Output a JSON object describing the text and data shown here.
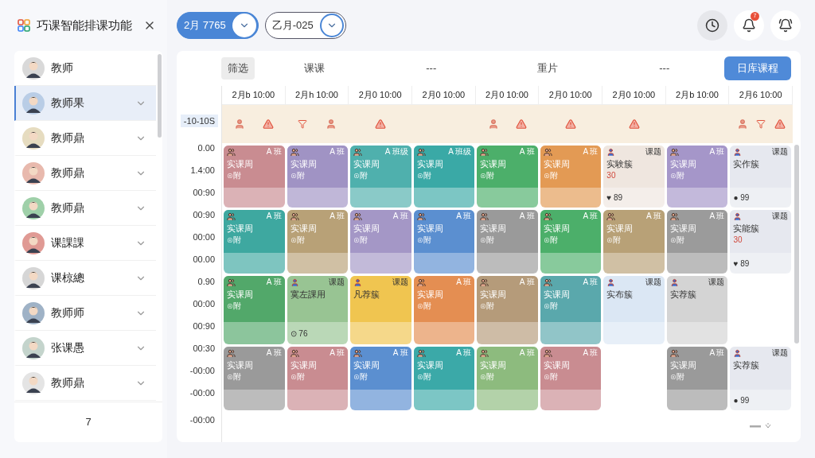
{
  "sidebar": {
    "title": "巧课智能排课功能",
    "teachers": [
      {
        "name": "教师",
        "color": "#d9d9d9",
        "expandable": false,
        "selected": false
      },
      {
        "name": "教师果",
        "color": "#b9cde6",
        "expandable": true,
        "selected": true
      },
      {
        "name": "教师鼎",
        "color": "#e6dcc0",
        "expandable": true,
        "selected": false
      },
      {
        "name": "教师鼎",
        "color": "#e8b9ad",
        "expandable": true,
        "selected": false
      },
      {
        "name": "教师鼎",
        "color": "#9fd0a9",
        "expandable": true,
        "selected": false
      },
      {
        "name": "课課課",
        "color": "#e09a94",
        "expandable": true,
        "selected": false
      },
      {
        "name": "课椋總",
        "color": "#d6d6d6",
        "expandable": true,
        "selected": false
      },
      {
        "name": "教师师",
        "color": "#9fb2c6",
        "expandable": true,
        "selected": false
      },
      {
        "name": "张课愚",
        "color": "#c4d4cc",
        "expandable": true,
        "selected": false
      },
      {
        "name": "教师鼎",
        "color": "#e4e4e4",
        "expandable": true,
        "selected": false
      }
    ],
    "footer": "7"
  },
  "filters": [
    {
      "label": "2月 7765",
      "selected": true
    },
    {
      "label": "乙月-025",
      "selected": false
    }
  ],
  "notification_badge": "7",
  "toolbar": {
    "tabs": [
      {
        "label": "筛选",
        "selected": true
      },
      {
        "label": "课课",
        "selected": false
      },
      {
        "label": "---",
        "selected": false
      },
      {
        "label": "重片",
        "selected": false
      },
      {
        "label": "---",
        "selected": false
      }
    ],
    "action": "日库课程"
  },
  "schedule": {
    "columns": [
      {
        "label": "2月b 10:00",
        "alerts": [
          {
            "kind": "person"
          },
          {
            "kind": "warning"
          }
        ]
      },
      {
        "label": "2月h 10:00",
        "alerts": [
          {
            "kind": "filter"
          },
          {
            "kind": "person"
          }
        ]
      },
      {
        "label": "2月0 10:00",
        "alerts": [
          {
            "kind": "warning"
          }
        ]
      },
      {
        "label": "2月0 10:00"
      },
      {
        "label": "2月0 10:00",
        "alerts": [
          {
            "kind": "person"
          },
          {
            "kind": "warning"
          }
        ]
      },
      {
        "label": "2月0 10:00",
        "alerts": [
          {
            "kind": "warning"
          }
        ]
      },
      {
        "label": "2月0 10:00",
        "alerts": [
          {
            "kind": "warning"
          }
        ]
      },
      {
        "label": "2月b 10:00"
      },
      {
        "label": "2月6 10:00",
        "alerts": [
          {
            "kind": "person"
          },
          {
            "kind": "filter"
          },
          {
            "kind": "warning"
          }
        ]
      }
    ],
    "times": [
      {
        "label": "-10-10S",
        "selected": true
      },
      {
        "label": "0.00",
        "selected": false
      },
      {
        "label": "1.4:00",
        "selected": false
      },
      {
        "label": "00:90",
        "selected": false
      },
      {
        "label": "00:90",
        "selected": false
      },
      {
        "label": "00:00",
        "selected": false
      },
      {
        "label": "00.00",
        "selected": false
      },
      {
        "label": "0.90",
        "selected": false
      },
      {
        "label": "00:00",
        "selected": false
      },
      {
        "label": "00:90",
        "selected": false
      },
      {
        "label": "00:30",
        "selected": false
      },
      {
        "label": "-00:00",
        "selected": false
      },
      {
        "label": "-00:00",
        "selected": false
      },
      {
        "label": "-00:00",
        "selected": false
      }
    ],
    "rows": [
      [
        {
          "kind": "class",
          "color": "#c98c91",
          "title": "实课周",
          "sub": "⊙附",
          "tag": "A 班"
        },
        {
          "kind": "class",
          "color": "#a093c4",
          "title": "实课周",
          "sub": "⊙附",
          "tag": "A 班"
        },
        {
          "kind": "class",
          "color": "#4fb0ad",
          "title": "实课周",
          "sub": "⊙附",
          "tag": "A 班级"
        },
        {
          "kind": "class",
          "color": "#3aa9a6",
          "title": "实课周",
          "sub": "⊙附",
          "tag": "A 班级"
        },
        {
          "kind": "class",
          "color": "#4caf6a",
          "title": "实课周",
          "sub": "⊙附",
          "tag": "A 班"
        },
        {
          "kind": "class",
          "color": "#e39a54",
          "title": "实课周",
          "sub": "⊙附",
          "tag": "A 班"
        },
        {
          "kind": "lab",
          "color": "#efe6df",
          "title": "实験簇",
          "note": "30",
          "foot": "♥ 89",
          "tag": "课题"
        },
        {
          "kind": "class",
          "color": "#a596c9",
          "title": "实课周",
          "sub": "⊙附",
          "tag": "A 班"
        },
        {
          "kind": "lab",
          "color": "#e6e8ef",
          "title": "实作簇",
          "foot": "● 99",
          "tag": "课题"
        }
      ],
      [
        {
          "kind": "class",
          "color": "#3ea8a0",
          "title": "实课周",
          "sub": "⊙附",
          "tag": "A 班"
        },
        {
          "kind": "class",
          "color": "#b8a177",
          "title": "实课周",
          "sub": "⊙附",
          "tag": "A 班"
        },
        {
          "kind": "class",
          "color": "#a497c6",
          "title": "实课周",
          "sub": "⊙附",
          "tag": "A 班"
        },
        {
          "kind": "class",
          "color": "#5b8fd0",
          "title": "实课周",
          "sub": "⊙附",
          "tag": "A 班"
        },
        {
          "kind": "class",
          "color": "#9a9a9a",
          "title": "实课周",
          "sub": "⊙附",
          "tag": "A 班"
        },
        {
          "kind": "class",
          "color": "#4caf6a",
          "title": "实课周",
          "sub": "⊙附",
          "tag": "A 班"
        },
        {
          "kind": "class",
          "color": "#b8a177",
          "title": "实课周",
          "sub": "⊙附",
          "tag": "A 班"
        },
        {
          "kind": "class",
          "color": "#9b9b9b",
          "title": "实课周",
          "sub": "⊙附",
          "tag": "A 班"
        },
        {
          "kind": "lab",
          "color": "#e6e8ef",
          "title": "实能簇",
          "note": "30",
          "foot": "♥ 89",
          "tag": "课题"
        }
      ],
      [
        {
          "kind": "class",
          "color": "#52a86a",
          "title": "实课周",
          "sub": "⊙附",
          "tag": "A 班"
        },
        {
          "kind": "lab",
          "color": "#98c493",
          "title": "寞左課用",
          "foot": "⊙ 76",
          "tag": "课题"
        },
        {
          "kind": "lab",
          "color": "#f0c550",
          "title": "凡荐簇",
          "tag": "课题"
        },
        {
          "kind": "class",
          "color": "#e48e52",
          "title": "实课周",
          "sub": "⊙附",
          "tag": "A 班"
        },
        {
          "kind": "class",
          "color": "#b59b7a",
          "title": "实课周",
          "sub": "⊙附",
          "tag": "A 班"
        },
        {
          "kind": "class",
          "color": "#5aa8ac",
          "title": "实课周",
          "sub": "⊙附",
          "tag": "A 班"
        },
        {
          "kind": "lab",
          "color": "#dbe7f4",
          "title": "实布簇",
          "tag": "课题"
        },
        {
          "kind": "lab",
          "color": "#d4d4d4",
          "title": "实荐簇",
          "tag": "课题"
        },
        null
      ],
      [
        {
          "kind": "class",
          "color": "#9a9a9a",
          "title": "实课周",
          "sub": "⊙附",
          "tag": "A 班"
        },
        {
          "kind": "class",
          "color": "#c98c91",
          "title": "实课周",
          "sub": "⊙附",
          "tag": "A 班"
        },
        {
          "kind": "class",
          "color": "#5b8fd0",
          "title": "实课周",
          "sub": "⊙附",
          "tag": "A 班"
        },
        {
          "kind": "class",
          "color": "#3ba9a8",
          "title": "实课周",
          "sub": "⊙附",
          "tag": "A 班"
        },
        {
          "kind": "class",
          "color": "#8dbb7e",
          "title": "实课周",
          "sub": "⊙附",
          "tag": "A 班"
        },
        {
          "kind": "class",
          "color": "#c98c91",
          "title": "实课周",
          "sub": "⊙附",
          "tag": "A 班"
        },
        null,
        {
          "kind": "class",
          "color": "#9a9a9a",
          "title": "实课周",
          "sub": "⊙附",
          "tag": "A 班"
        },
        {
          "kind": "lab",
          "color": "#e6e8ef",
          "title": "实荐簇",
          "foot": "● 99",
          "tag": "课题"
        }
      ]
    ]
  }
}
